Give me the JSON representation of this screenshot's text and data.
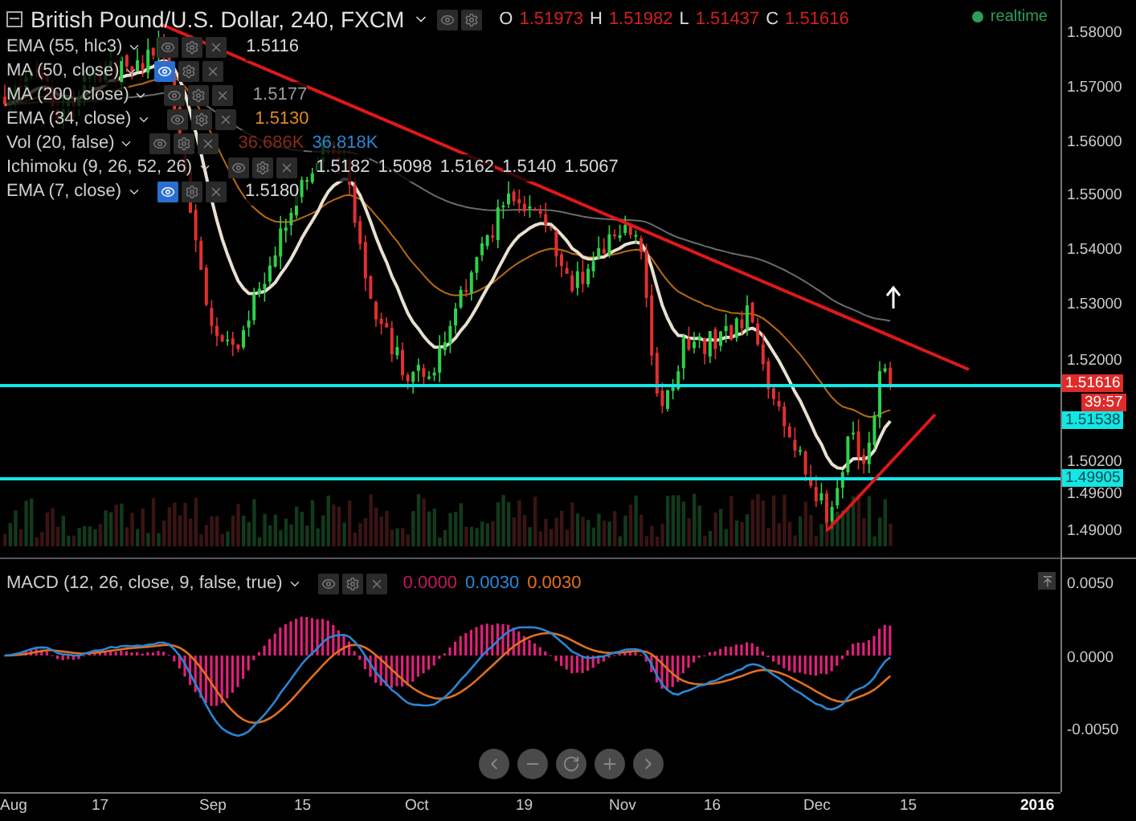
{
  "header": {
    "title": "British Pound/U.S. Dollar, 240, FXCM",
    "ohlc": [
      {
        "label": "O",
        "value": "1.51973"
      },
      {
        "label": "H",
        "value": "1.51982"
      },
      {
        "label": "L",
        "value": "1.51437"
      },
      {
        "label": "C",
        "value": "1.51616"
      }
    ]
  },
  "status": {
    "text": "realtime",
    "color": "#2e9e5b"
  },
  "indicators": [
    {
      "name": "EMA (55, hlc3)",
      "visible": false,
      "values": [
        {
          "text": "1.5116",
          "color": "#d8d8d8"
        }
      ]
    },
    {
      "name": "MA (50, close)",
      "visible": true
    },
    {
      "name": "MA (200, close)",
      "visible": false,
      "values": [
        {
          "text": "1.5177",
          "color": "#9a9a9a"
        }
      ]
    },
    {
      "name": "EMA (34, close)",
      "visible": false,
      "values": [
        {
          "text": "1.5130",
          "color": "#e08a1e"
        }
      ]
    },
    {
      "name": "Vol (20, false)",
      "visible": false,
      "values": [
        {
          "text": "36.686K",
          "color": "#8b2a1a"
        },
        {
          "text": "36.818K",
          "color": "#2a86d4"
        }
      ]
    },
    {
      "name": "Ichimoku (9, 26, 52, 26)",
      "visible": false,
      "values": [
        {
          "text": "1.5182",
          "color": "#d8d8d8"
        },
        {
          "text": "1.5098",
          "color": "#d8d8d8"
        },
        {
          "text": "1.5162",
          "color": "#d8d8d8"
        },
        {
          "text": "1.5140",
          "color": "#d8d8d8"
        },
        {
          "text": "1.5067",
          "color": "#d8d8d8"
        }
      ]
    },
    {
      "name": "EMA (7, close)",
      "visible": true,
      "values": [
        {
          "text": "1.5180",
          "color": "#d8d8d8"
        }
      ]
    }
  ],
  "price_axis": {
    "ticks": [
      "1.58000",
      "1.57000",
      "1.56000",
      "1.55000",
      "1.54000",
      "1.53000",
      "1.52000",
      "1.50200",
      "1.49600",
      "1.49000"
    ],
    "markers": [
      {
        "text": "1.51616",
        "color": "#e02a2a"
      },
      {
        "text": "39:57",
        "color": "#e02a2a"
      },
      {
        "text": "1.51538",
        "color": "#14e6e6"
      },
      {
        "text": "1.49905",
        "color": "#14e6e6"
      }
    ]
  },
  "macd": {
    "name": "MACD (12, 26, close, 9, false, true)",
    "visible": false,
    "values": [
      {
        "text": "0.0000",
        "color": "#c2185b"
      },
      {
        "text": "0.0030",
        "color": "#2a86d4"
      },
      {
        "text": "0.0030",
        "color": "#e07020"
      }
    ],
    "ticks": [
      "0.0050",
      "0.0000",
      "-0.0050"
    ]
  },
  "time_axis": [
    "Aug",
    "17",
    "Sep",
    "15",
    "Oct",
    "19",
    "Nov",
    "16",
    "Dec",
    "15",
    "2016"
  ]
}
